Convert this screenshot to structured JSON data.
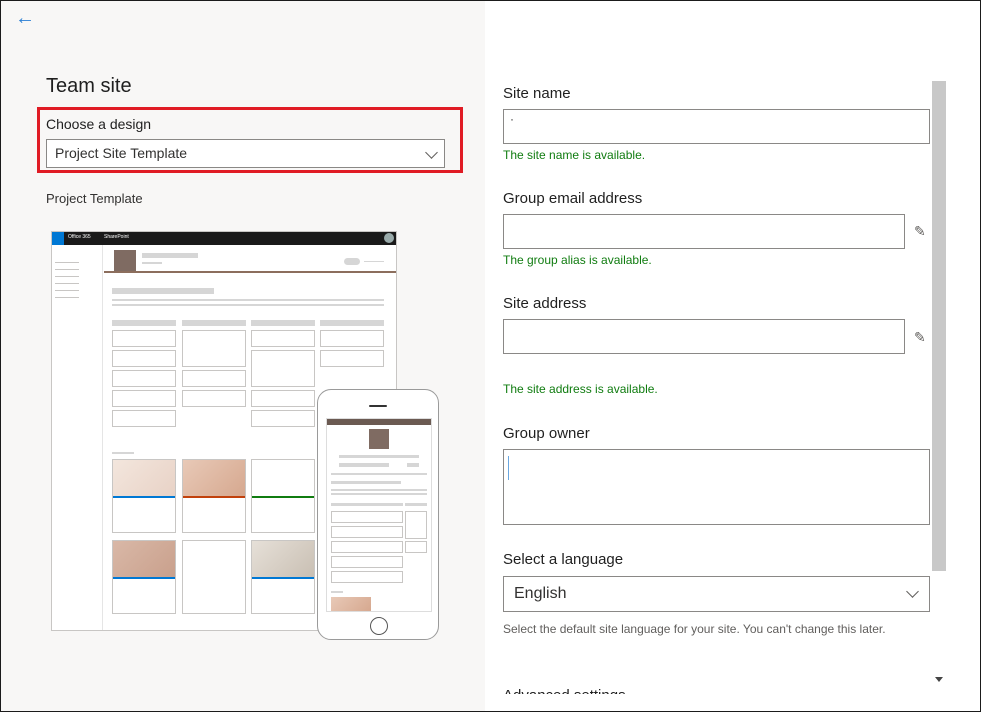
{
  "left_panel": {
    "back_label": "←",
    "title": "Team site",
    "design_label": "Choose a design",
    "design_value": "Project Site Template",
    "template_caption": "Project Template"
  },
  "preview": {
    "topbar_app": "Office 365",
    "topbar_site": "SharePoint"
  },
  "right_panel": {
    "site_name_label": "Site name",
    "site_name_value": "·",
    "site_name_status": "The site name is available.",
    "group_email_label": "Group email address",
    "group_email_status": "The group alias is available.",
    "site_address_label": "Site address",
    "site_address_status": "The site address is available.",
    "group_owner_label": "Group owner",
    "language_label": "Select a language",
    "language_value": "English",
    "language_help": "Select the default site language for your site. You can't change this later.",
    "advanced_label": "Advanced settings"
  },
  "colors": {
    "highlight": "#e01b24",
    "success": "#107c10",
    "accent": "#0078d4"
  }
}
